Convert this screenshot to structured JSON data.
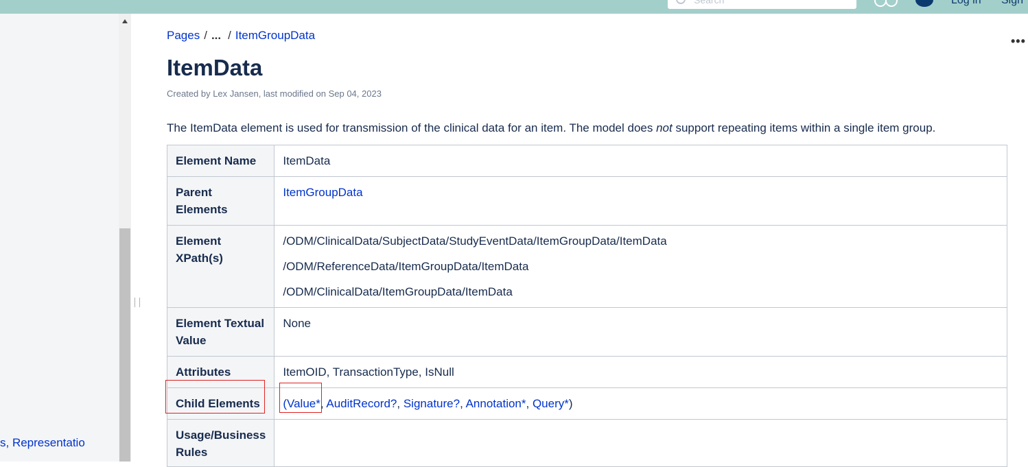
{
  "header": {
    "search_placeholder": "Search",
    "login_label": "Log in",
    "signup_label": "Sign",
    "help_icon": "help-icon",
    "apps_icon": "apps-icon"
  },
  "sidebar": {
    "visible_link": "s, Representatio"
  },
  "breadcrumb": {
    "root": "Pages",
    "ellipsis": "...",
    "parent": "ItemGroupData",
    "separator": "/"
  },
  "page": {
    "more_icon": "•••",
    "title": "ItemData",
    "byline": "Created by Lex Jansen, last modified on Sep 04, 2023",
    "intro_before": "The ItemData element is used for transmission of the clinical data for an item. The model does ",
    "intro_em": "not",
    "intro_after": " support repeating items within a single item group."
  },
  "table": {
    "element_name": {
      "label": "Element Name",
      "value": "ItemData"
    },
    "parent_elements": {
      "label": "Parent Elements",
      "value": "ItemGroupData"
    },
    "xpaths": {
      "label": "Element XPath(s)",
      "values": [
        "/ODM/ClinicalData/SubjectData/StudyEventData/ItemGroupData/ItemData",
        "/ODM/ReferenceData/ItemGroupData/ItemData",
        "/ODM/ClinicalData/ItemGroupData/ItemData"
      ]
    },
    "textual_value": {
      "label": "Element Textual Value",
      "value": "None"
    },
    "attributes": {
      "label": "Attributes",
      "value": "ItemOID, TransactionType, IsNull"
    },
    "child_elements": {
      "label": "Child Elements",
      "open": "(",
      "items": [
        "Value*",
        "AuditRecord?",
        "Signature?",
        "Annotation*",
        "Query*"
      ],
      "separator": ", ",
      "close": ")"
    },
    "usage": {
      "label": "Usage/Business Rules",
      "value": ""
    }
  },
  "colors": {
    "header_bg": "#a3cfcb",
    "link": "#0033cc",
    "highlight": "#e02020",
    "heading": "#172b4d"
  }
}
